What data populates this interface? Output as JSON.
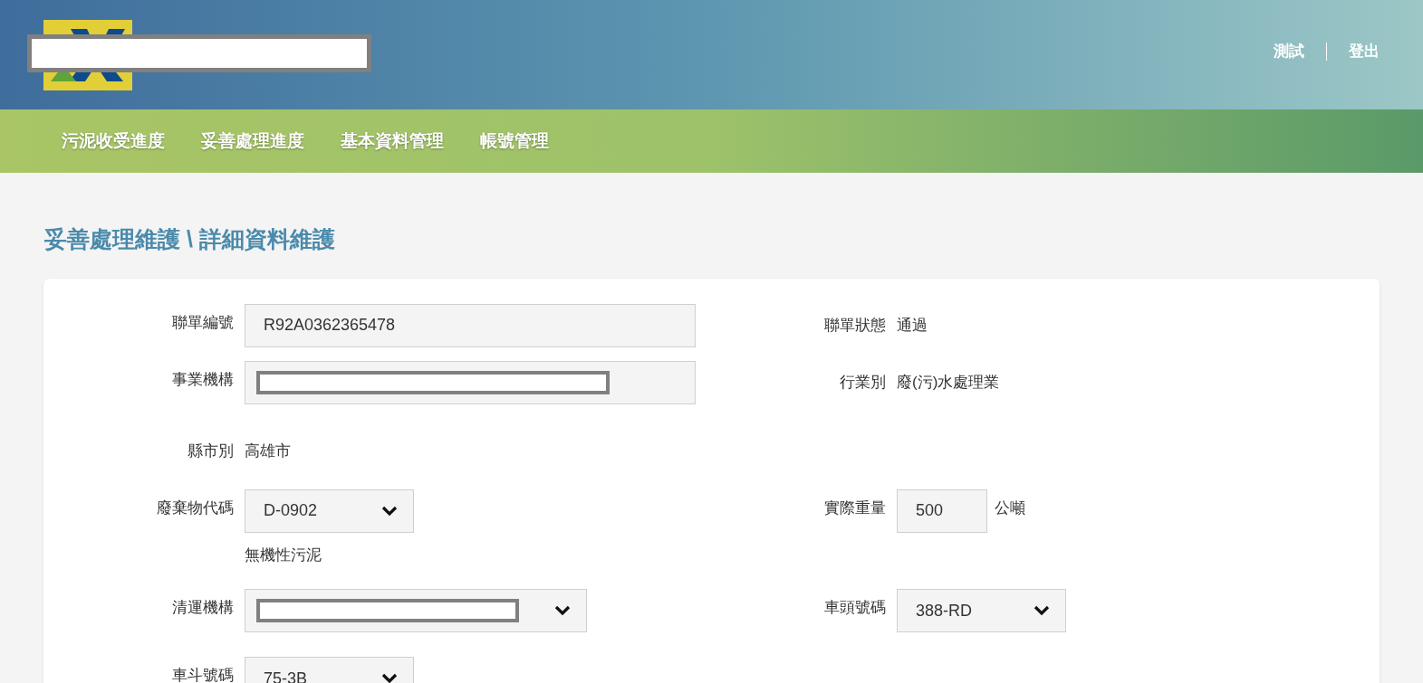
{
  "header": {
    "user_links": [
      "測試",
      "登出"
    ]
  },
  "nav": {
    "items": [
      "污泥收受進度",
      "妥善處理進度",
      "基本資料管理",
      "帳號管理"
    ]
  },
  "page_title": "妥善處理維護 \\ 詳細資料維護",
  "form": {
    "rows": [
      {
        "left": {
          "label": "聯單編號",
          "kind": "input",
          "value": "R92A0362365478"
        },
        "right": {
          "label": "聯單狀態",
          "kind": "text",
          "value": "通過"
        }
      },
      {
        "left": {
          "label": "事業機構",
          "kind": "redacted-input"
        },
        "right": {
          "label": "行業別",
          "kind": "text",
          "value": "廢(污)水處理業"
        }
      },
      {
        "left": {
          "label": "縣市別",
          "kind": "text",
          "value": "高雄市"
        }
      },
      {
        "left": {
          "label": "廢棄物代碼",
          "kind": "select",
          "value": "D-0902",
          "note": "無機性污泥"
        },
        "right": {
          "label": "實際重量",
          "kind": "input",
          "value": "500",
          "unit": "公噸"
        }
      },
      {
        "left": {
          "label": "清運機構",
          "kind": "redacted-select"
        },
        "right": {
          "label": "車頭號碼",
          "kind": "select",
          "value": "388-RD"
        }
      },
      {
        "left": {
          "label": "車斗號碼",
          "kind": "select",
          "value": "75-3B"
        }
      }
    ]
  }
}
